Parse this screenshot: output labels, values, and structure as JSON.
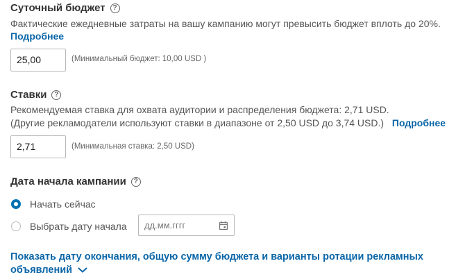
{
  "budget": {
    "title": "Суточный бюджет",
    "help_icon": "question-circle-icon",
    "description": "Фактические ежедневные затраты на вашу кампанию могут превысить бюджет вплоть до 20%.",
    "more_link": "Подробнее",
    "value": "25,00",
    "hint": "(Минимальный бюджет: 10,00 USD )"
  },
  "bids": {
    "title": "Ставки",
    "help_icon": "question-circle-icon",
    "description_line1": "Рекомендуемая ставка для охвата аудитории и распределения бюджета: 2,71 USD.",
    "description_line2": "(Другие рекламодатели используют ставки в диапазоне от 2,50 USD до 3,74 USD.)",
    "more_link": "Подробнее",
    "value": "2,71",
    "hint": "(Минимальная ставка: 2,50 USD)"
  },
  "start_date": {
    "title": "Дата начала кампании",
    "help_icon": "question-circle-icon",
    "option_now": "Начать сейчас",
    "option_pick": "Выбрать дату начала",
    "selected": "option_now",
    "date_placeholder": "дд.мм.гггг",
    "calendar_icon": "calendar-icon"
  },
  "expand_link": {
    "line1": "Показать дату окончания, общую сумму бюджета и варианты ротации рекламных",
    "line2": "объявлений",
    "icon": "chevron-down-icon"
  },
  "colors": {
    "link": "#0a66a8",
    "radio_selected": "#0073b1"
  }
}
